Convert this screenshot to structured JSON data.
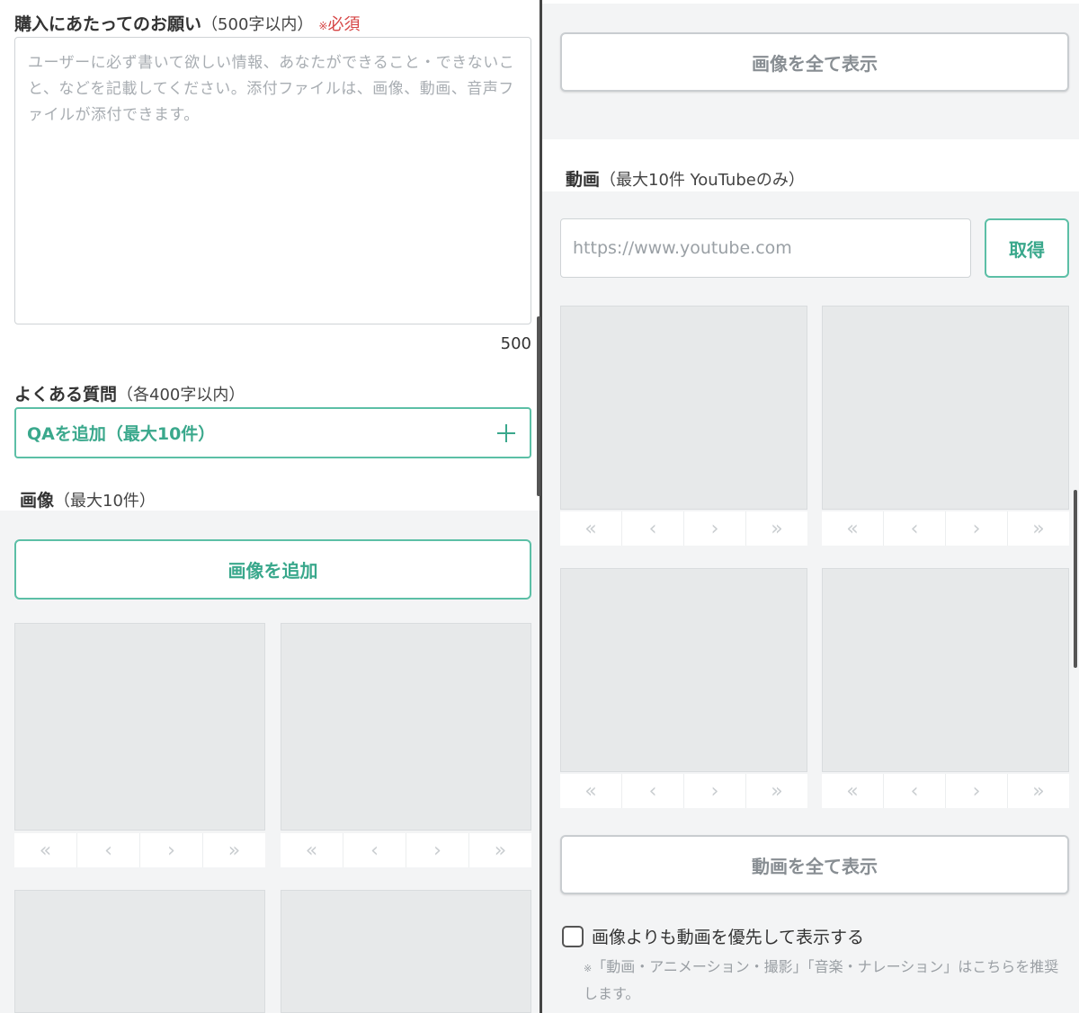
{
  "purchase_request": {
    "title": "購入にあたってのお願い",
    "limit": "（500字以内）",
    "required_mark": "※",
    "required_text": "必須",
    "placeholder": "ユーザーに必ず書いて欲しい情報、あなたができること・できないこと、などを記載してください。添付ファイルは、画像、動画、音声ファイルが添付できます。",
    "char_count": "500"
  },
  "faq": {
    "title": "よくある質問",
    "limit": "（各400字以内）",
    "add_button": "QAを追加（最大10件）",
    "add_icon": "plus-icon"
  },
  "images": {
    "title": "画像",
    "limit": "（最大10件）",
    "add_button": "画像を追加",
    "show_all_button": "画像を全て表示"
  },
  "videos": {
    "title": "動画",
    "limit": "（最大10件 YouTubeのみ）",
    "url_placeholder": "https://www.youtube.com",
    "fetch_button": "取得",
    "show_all_button": "動画を全て表示"
  },
  "thumb_nav": {
    "first": "«",
    "prev": "‹",
    "next": "›",
    "last": "»"
  },
  "priority": {
    "checkbox_label": "画像よりも動画を優先して表示する",
    "checked": false,
    "note_mark": "※",
    "note_text": "「動画・アニメーション・撮影」「音楽・ナレーション」はこちらを推奨します。"
  },
  "colors": {
    "accent": "#3aa88c",
    "accent_border": "#5cbfa6",
    "required": "#d64545",
    "panel_gray": "#f3f4f5"
  }
}
